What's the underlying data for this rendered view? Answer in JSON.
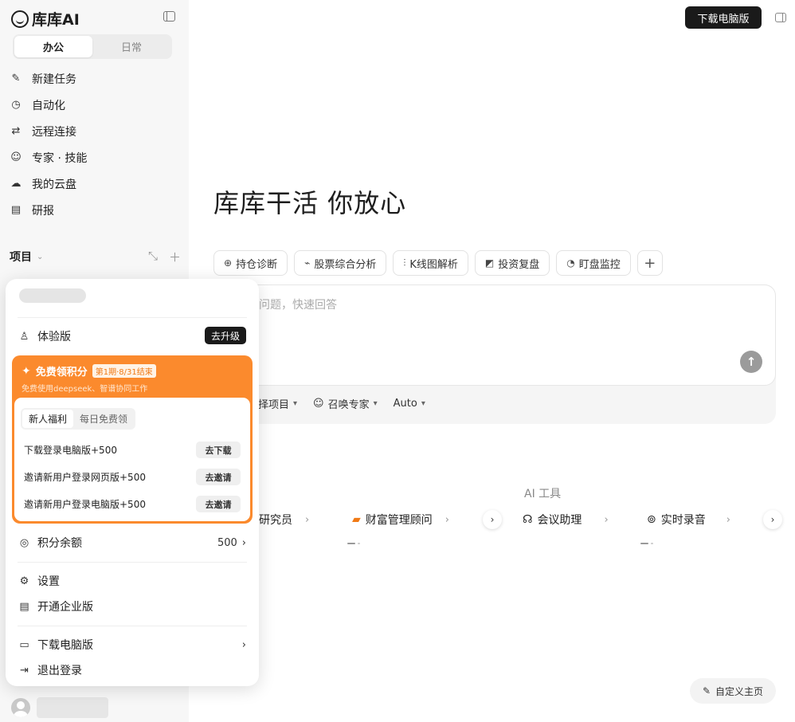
{
  "sidebar": {
    "logo": "库库AI",
    "segments": [
      "办公",
      "日常"
    ],
    "nav": [
      {
        "label": "新建任务",
        "icon": "edit-icon"
      },
      {
        "label": "自动化",
        "icon": "clock-icon"
      },
      {
        "label": "远程连接",
        "icon": "route-icon"
      },
      {
        "label": "专家 · 技能",
        "icon": "smile-icon"
      },
      {
        "label": "我的云盘",
        "icon": "cloud-icon"
      },
      {
        "label": "研报",
        "icon": "report-icon"
      }
    ],
    "projects_label": "项目"
  },
  "header": {
    "download_label": "下载电脑版"
  },
  "main": {
    "headline": "库库干活 你放心",
    "chips": [
      "持仓诊断",
      "股票综合分析",
      "K线图解析",
      "投资复盘",
      "盯盘监控"
    ],
    "input_placeholder": "问题，快速回答",
    "options": [
      "择项目",
      "召唤专家",
      "Auto"
    ],
    "ai_tools_title": "AI 工具",
    "tools": [
      "研究员",
      "财富管理顾问",
      "会议助理",
      "实时录音"
    ],
    "customize_label": "自定义主页"
  },
  "popup": {
    "plan_label": "体验版",
    "upgrade_label": "去升级",
    "promo": {
      "title": "免费领积分",
      "tag": "第1期·8/31结束",
      "subtitle": "免费使用deepseek、智谱协同工作",
      "tabs": [
        "新人福利",
        "每日免费领"
      ],
      "tasks": [
        {
          "label": "下载登录电脑版+500",
          "action": "去下载"
        },
        {
          "label": "邀请新用户登录网页版+500",
          "action": "去邀请"
        },
        {
          "label": "邀请新用户登录电脑版+500",
          "action": "去邀请"
        }
      ]
    },
    "points_label": "积分余额",
    "points_value": "500",
    "settings_label": "设置",
    "enterprise_label": "开通企业版",
    "download_label": "下载电脑版",
    "logout_label": "退出登录"
  },
  "colors": {
    "accent": "#fb8a2d",
    "dark": "#1a1a1a"
  }
}
